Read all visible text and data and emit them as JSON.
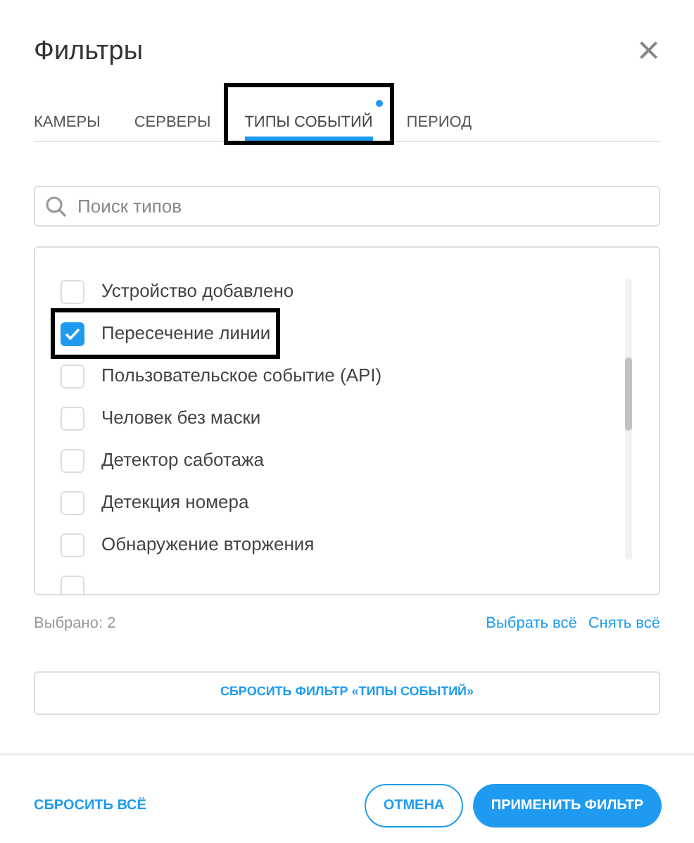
{
  "dialog": {
    "title": "Фильтры",
    "close": "×"
  },
  "tabs": [
    {
      "label": "КАМЕРЫ",
      "selected": false,
      "indicator": false,
      "highlighted": false
    },
    {
      "label": "СЕРВЕРЫ",
      "selected": false,
      "indicator": false,
      "highlighted": false
    },
    {
      "label": "ТИПЫ СОБЫТИЙ",
      "selected": true,
      "indicator": true,
      "highlighted": true
    },
    {
      "label": "ПЕРИОД",
      "selected": false,
      "indicator": false,
      "highlighted": false
    }
  ],
  "search": {
    "placeholder": "Поиск типов"
  },
  "event_types": [
    {
      "label": "Устройство добавлено",
      "checked": false,
      "highlighted": false
    },
    {
      "label": "Пересечение линии",
      "checked": true,
      "highlighted": true
    },
    {
      "label": "Пользовательское событие (API)",
      "checked": false,
      "highlighted": false
    },
    {
      "label": "Человек без маски",
      "checked": false,
      "highlighted": false
    },
    {
      "label": "Детектор саботажа",
      "checked": false,
      "highlighted": false
    },
    {
      "label": "Детекция номера",
      "checked": false,
      "highlighted": false
    },
    {
      "label": "Обнаружение вторжения",
      "checked": false,
      "highlighted": false
    },
    {
      "checked": false,
      "highlighted": false
    }
  ],
  "selection": {
    "count": "Выбрано: 2",
    "select_all": "Выбрать всё",
    "clear_all": "Снять всё"
  },
  "reset_filter": "СБРОСИТЬ ФИЛЬТР «ТИПЫ СОБЫТИЙ»",
  "footer": {
    "reset_all": "СБРОСИТЬ ВСЁ",
    "cancel": "ОТМЕНА",
    "apply": "ПРИМЕНИТЬ ФИЛЬТР"
  }
}
